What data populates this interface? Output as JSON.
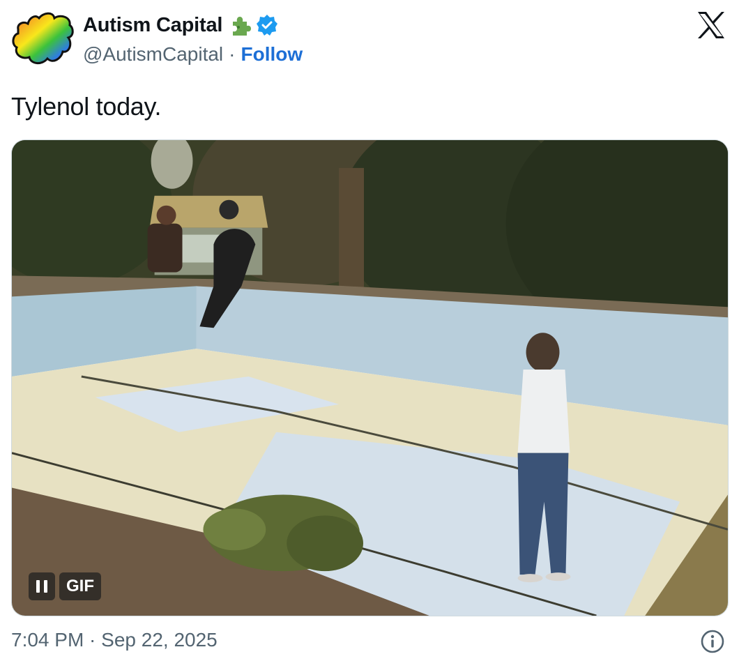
{
  "author": {
    "display_name": "Autism Capital",
    "handle": "@AutismCapital",
    "separator": "·",
    "follow_label": "Follow",
    "avatar_icon": "rainbow-puzzle-piece",
    "name_emoji_icon": "green-puzzle-piece",
    "verified_icon": "verified-badge",
    "colors": {
      "follow": "#1d6fd6",
      "verified": "#1d9bf0",
      "puzzle_emoji": "#6aa84f"
    }
  },
  "platform_icon": "x-logo",
  "tweet": {
    "text": "Tylenol today.",
    "media": {
      "type": "gif",
      "badge_label": "GIF",
      "pause_icon": "pause-icon"
    },
    "timestamp": "7:04 PM · Sep 22, 2025"
  },
  "footer": {
    "info_icon": "info-icon"
  }
}
